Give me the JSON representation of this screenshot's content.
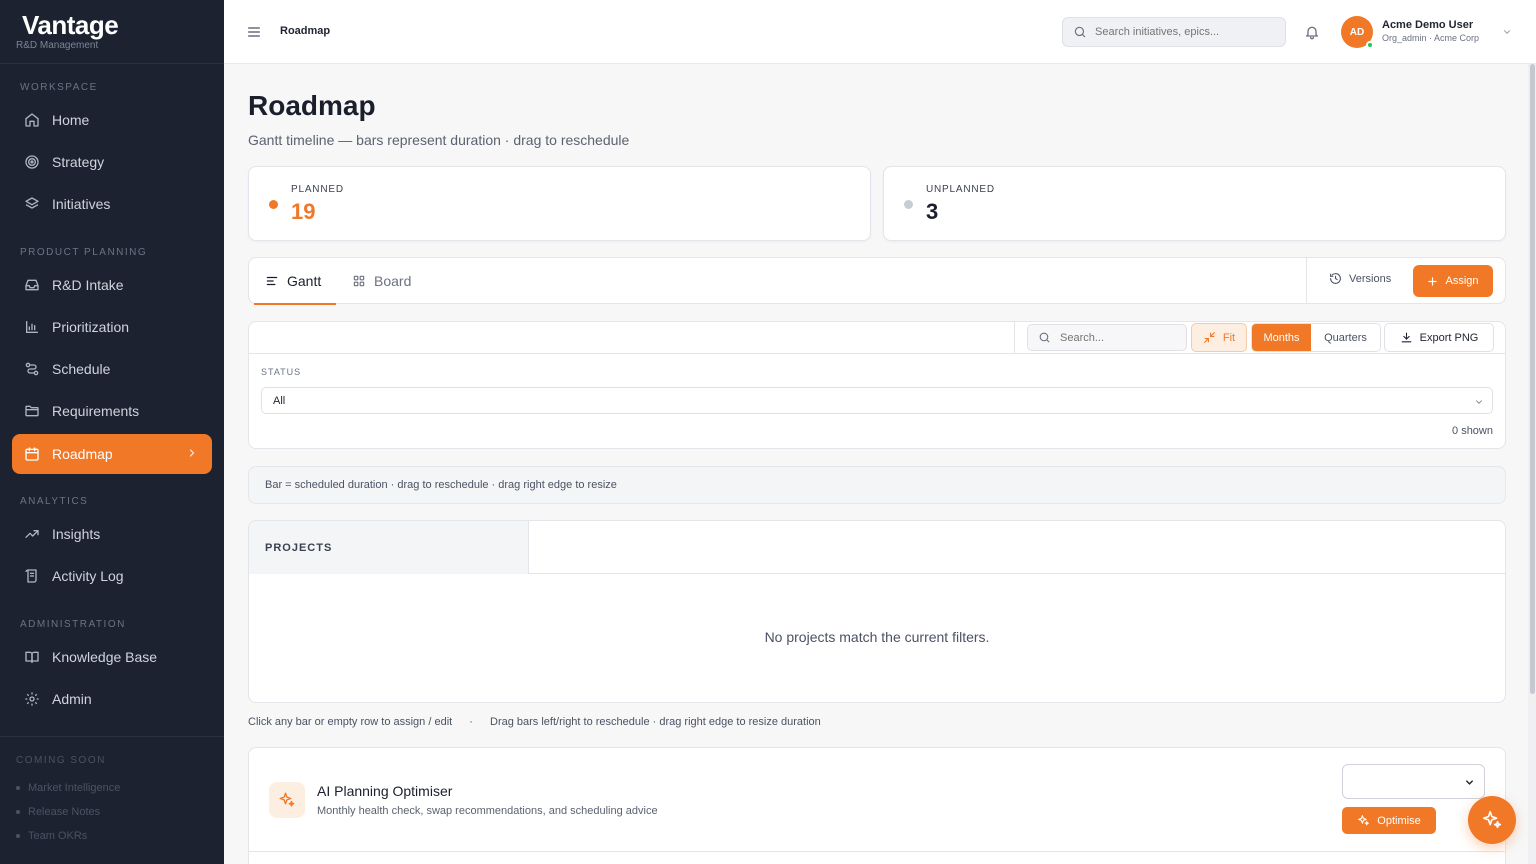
{
  "brand": {
    "name": "Vantage",
    "tagline": "R&D Management"
  },
  "sidebar": {
    "sections": [
      {
        "title": "WORKSPACE"
      },
      {
        "title": "PRODUCT PLANNING"
      },
      {
        "title": "ANALYTICS"
      },
      {
        "title": "ADMINISTRATION"
      }
    ],
    "items": [
      {
        "label": "Home",
        "icon": "home-icon"
      },
      {
        "label": "Strategy",
        "icon": "target-icon"
      },
      {
        "label": "Initiatives",
        "icon": "layers-icon"
      },
      {
        "label": "R&D Intake",
        "icon": "inbox-icon"
      },
      {
        "label": "Prioritization",
        "icon": "bar-chart-icon"
      },
      {
        "label": "Schedule",
        "icon": "route-icon"
      },
      {
        "label": "Requirements",
        "icon": "folder-icon"
      },
      {
        "label": "Roadmap",
        "icon": "calendar-icon",
        "active": true
      },
      {
        "label": "Insights",
        "icon": "trending-up-icon"
      },
      {
        "label": "Activity Log",
        "icon": "scroll-icon"
      },
      {
        "label": "Knowledge Base",
        "icon": "book-icon"
      },
      {
        "label": "Admin",
        "icon": "gear-icon"
      }
    ],
    "coming_soon": {
      "title": "COMING SOON",
      "items": [
        "Market Intelligence",
        "Release Notes",
        "Team OKRs"
      ]
    }
  },
  "topbar": {
    "breadcrumb": "Roadmap",
    "search_placeholder": "Search initiatives, epics...",
    "user": {
      "initials": "AD",
      "name": "Acme Demo User",
      "role": "Org_admin · Acme Corp"
    }
  },
  "page": {
    "title": "Roadmap",
    "subtitle": "Gantt timeline — bars represent duration · drag to reschedule"
  },
  "stats": {
    "planned": {
      "label": "PLANNED",
      "value": "19",
      "color": "#f07826"
    },
    "unplanned": {
      "label": "UNPLANNED",
      "value": "3",
      "color": "#c8ccd3"
    }
  },
  "view_tabs": {
    "gantt": "Gantt",
    "board": "Board",
    "versions": "Versions",
    "assign": "Assign"
  },
  "toolbar": {
    "search_placeholder": "Search...",
    "fit": "Fit",
    "months": "Months",
    "quarters": "Quarters",
    "export": "Export PNG"
  },
  "filters": {
    "status_label": "STATUS",
    "status_value": "All",
    "shown": "0 shown"
  },
  "hint": "Bar = scheduled duration · drag to reschedule · drag right edge to resize",
  "gantt": {
    "projects_header": "PROJECTS",
    "empty_message": "No projects match the current filters."
  },
  "legend": {
    "click_hint": "Click any bar or empty row to assign / edit",
    "separator": "·",
    "drag_hint": "Drag bars left/right to reschedule · drag right edge to resize duration"
  },
  "ai_optimiser": {
    "title": "AI Planning Optimiser",
    "description": "Monthly health check, swap recommendations, and scheduling advice",
    "select_value": "",
    "button": "Optimise"
  },
  "colors": {
    "accent": "#f07826",
    "sidebar_bg": "#1c2230"
  }
}
